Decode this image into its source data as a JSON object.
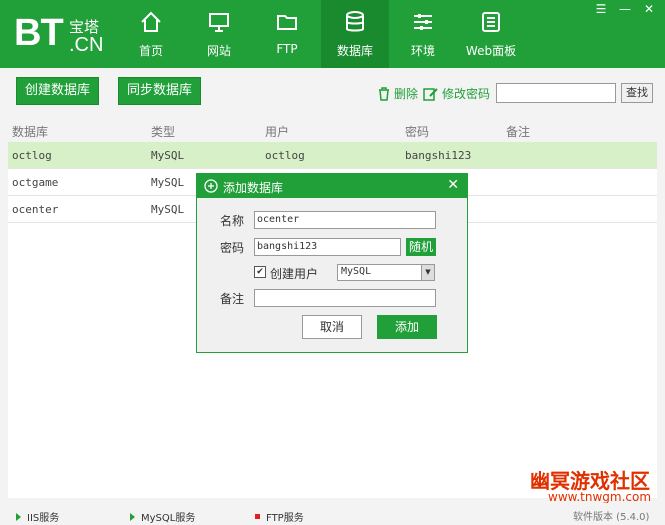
{
  "logo": {
    "bt": "BT",
    "top": "宝塔",
    "bottom": ".CN"
  },
  "nav": [
    {
      "label": "首页",
      "icon": "home-icon"
    },
    {
      "label": "网站",
      "icon": "monitor-icon"
    },
    {
      "label": "FTP",
      "icon": "folder-icon"
    },
    {
      "label": "数据库",
      "icon": "database-icon"
    },
    {
      "label": "环境",
      "icon": "sliders-icon"
    },
    {
      "label": "Web面板",
      "icon": "list-icon"
    }
  ],
  "toolbar": {
    "create_db": "创建数据库",
    "sync_db": "同步数据库",
    "delete": "删除",
    "change_password": "修改密码",
    "search_value": "",
    "search_button": "查找"
  },
  "table": {
    "headers": [
      "数据库",
      "类型",
      "用户",
      "密码",
      "备注"
    ],
    "rows": [
      {
        "db": "octlog",
        "type": "MySQL",
        "user": "octlog",
        "password": "bangshi123",
        "note": ""
      },
      {
        "db": "octgame",
        "type": "MySQL",
        "user": "",
        "password": "",
        "note": ""
      },
      {
        "db": "ocenter",
        "type": "MySQL",
        "user": "",
        "password": "",
        "note": ""
      }
    ]
  },
  "dialog": {
    "title": "添加数据库",
    "name_label": "名称",
    "name_value": "ocenter",
    "password_label": "密码",
    "password_value": "bangshi123",
    "random_button": "随机",
    "create_user_label": "创建用户",
    "create_user_checked": true,
    "db_type": "MySQL",
    "note_label": "备注",
    "note_value": "",
    "cancel": "取消",
    "add": "添加"
  },
  "footer": {
    "iis": "IIS服务",
    "mysql": "MySQL服务",
    "ftp": "FTP服务",
    "version": "软件版本 (5.4.0)"
  },
  "watermark": {
    "title": "幽冥游戏社区",
    "url": "www.tnwgm.com"
  },
  "colors": {
    "brand": "#21a03a",
    "selected_row": "#d8f0c8",
    "stopped": "#e02020"
  }
}
